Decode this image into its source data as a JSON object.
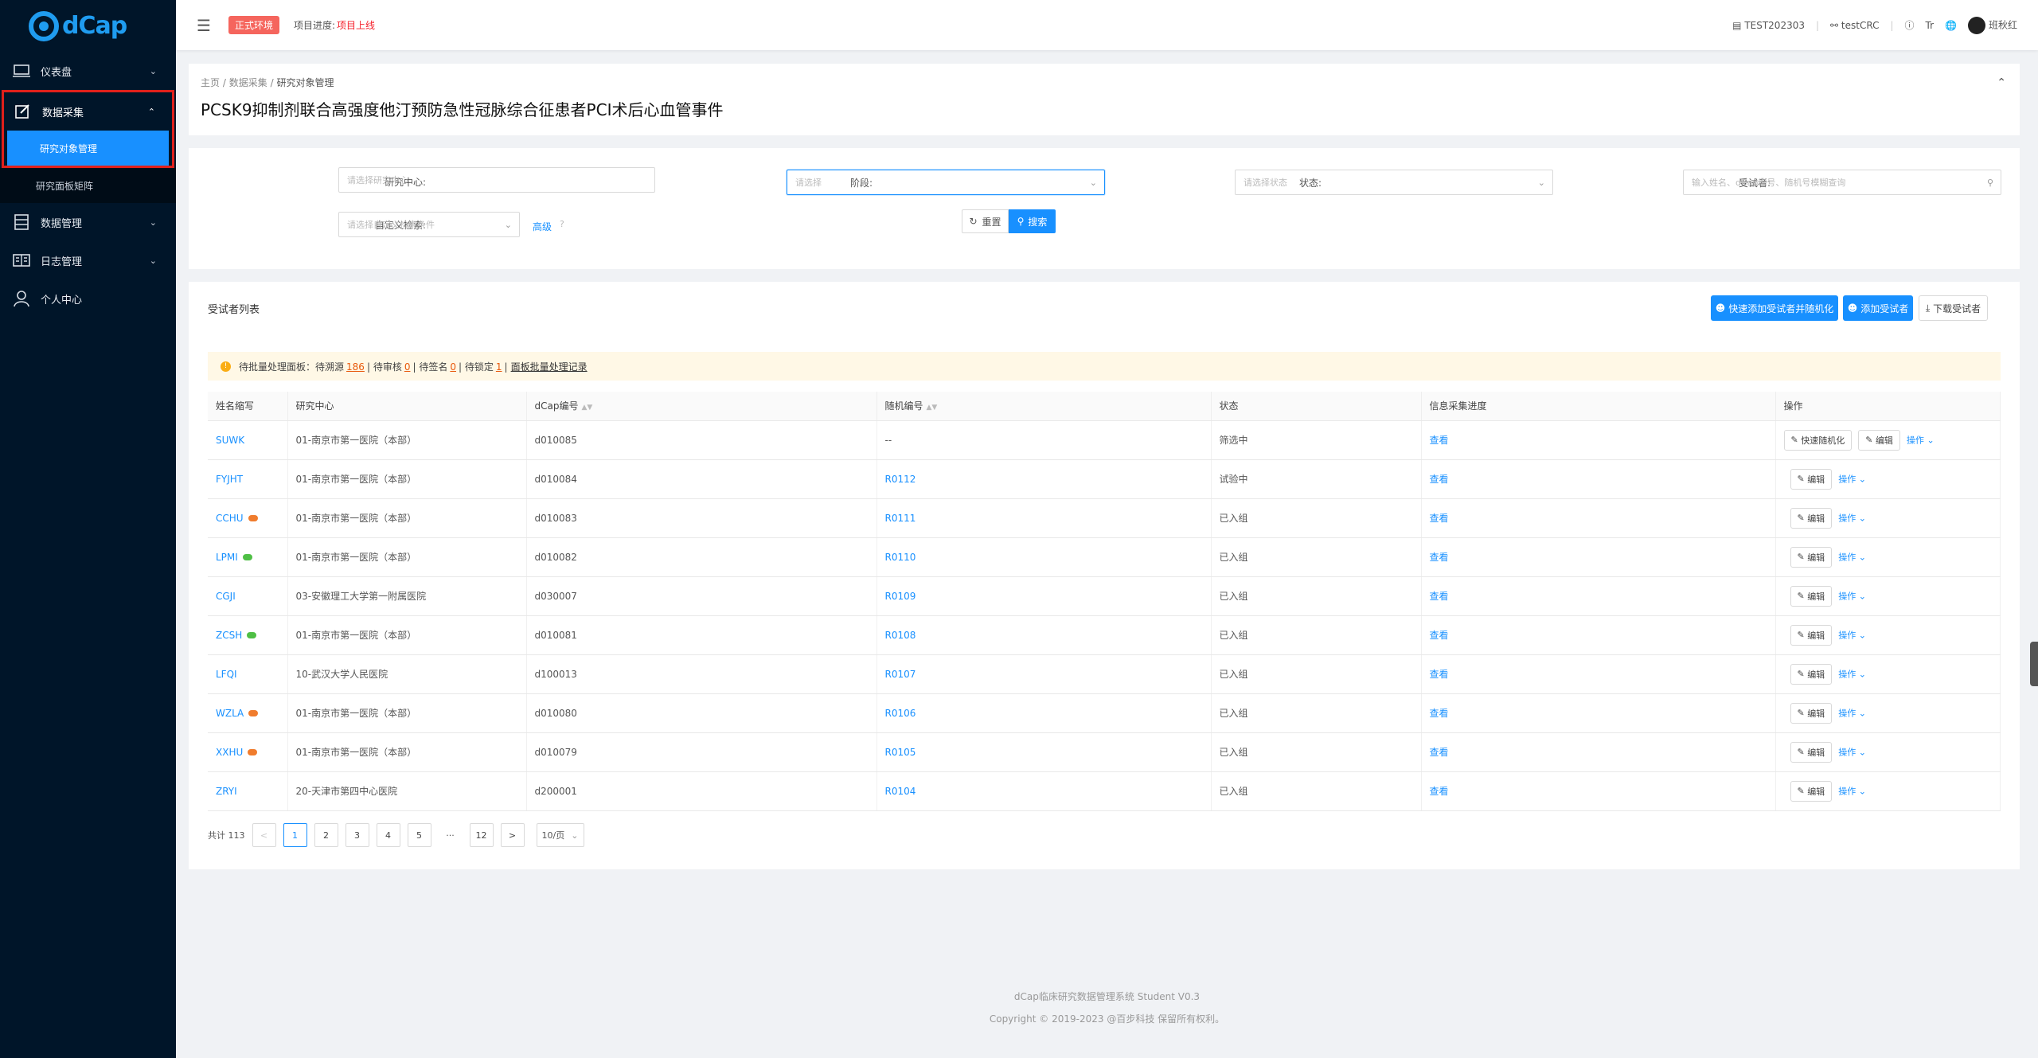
{
  "app": {
    "logo_text": "dCap"
  },
  "sidebar": {
    "items": [
      {
        "label": "仪表盘",
        "icon": "monitor-icon",
        "has_chevron": true
      },
      {
        "label": "数据采集",
        "icon": "edit-icon",
        "has_chevron": true,
        "expanded": true
      },
      {
        "label": "数据管理",
        "icon": "database-icon",
        "has_chevron": true
      },
      {
        "label": "日志管理",
        "icon": "book-icon",
        "has_chevron": true
      },
      {
        "label": "个人中心",
        "icon": "user-icon",
        "has_chevron": false
      }
    ],
    "sub_items": [
      {
        "label": "研究对象管理",
        "selected": true
      },
      {
        "label": "研究面板矩阵",
        "selected": false
      }
    ]
  },
  "topbar": {
    "env_badge": "正式环境",
    "progress_label": "项目进度:",
    "progress_value": "项目上线",
    "project_code": "TEST202303",
    "role": "testCRC",
    "font_icon_text": "Tr",
    "user_name": "班秋红"
  },
  "header": {
    "breadcrumb": [
      "主页",
      "数据采集",
      "研究对象管理"
    ],
    "breadcrumb_sep": "/",
    "title": "PCSK9抑制剂联合高强度他汀预防急性冠脉综合征患者PCI术后心血管事件"
  },
  "filters": {
    "center_label": "研究中心:",
    "center_placeholder": "请选择研究中心",
    "stage_label": "阶段:",
    "stage_placeholder": "请选择",
    "status_label": "状态:",
    "status_placeholder": "请选择状态",
    "subject_label": "受试者:",
    "subject_placeholder": "输入姓名、dCap编号、随机号模糊查询",
    "custom_label": "自定义检索:",
    "custom_placeholder": "请选择自定义检索条件",
    "advanced": "高级",
    "reset": "重置",
    "search": "搜索"
  },
  "list": {
    "title": "受试者列表",
    "quick_add_button": "快速添加受试者并随机化",
    "add_button": "添加受试者",
    "download_button": "下载受试者",
    "alert_prefix": "待批量处理面板：",
    "alert_items": [
      {
        "label": "待溯源",
        "count": "186"
      },
      {
        "label": "待审核",
        "count": "0"
      },
      {
        "label": "待签名",
        "count": "0"
      },
      {
        "label": "待锁定",
        "count": "1"
      }
    ],
    "alert_link": "面板批量处理记录",
    "columns": [
      "姓名缩写",
      "研究中心",
      "dCap编号",
      "随机编号",
      "状态",
      "信息采集进度",
      "操作"
    ],
    "rows": [
      {
        "name": "SUWK",
        "center": "01-南京市第一医院（本部）",
        "dcap": "d010085",
        "rand": "--",
        "status": "筛选中",
        "progress": "查看",
        "chat": "",
        "quick_rand": "快速随机化"
      },
      {
        "name": "FYJHT",
        "center": "01-南京市第一医院（本部）",
        "dcap": "d010084",
        "rand": "R0112",
        "status": "试验中",
        "progress": "查看",
        "chat": ""
      },
      {
        "name": "CCHU",
        "center": "01-南京市第一医院（本部）",
        "dcap": "d010083",
        "rand": "R0111",
        "status": "已入组",
        "progress": "查看",
        "chat": "orange"
      },
      {
        "name": "LPMI",
        "center": "01-南京市第一医院（本部）",
        "dcap": "d010082",
        "rand": "R0110",
        "status": "已入组",
        "progress": "查看",
        "chat": "green"
      },
      {
        "name": "CGJI",
        "center": "03-安徽理工大学第一附属医院",
        "dcap": "d030007",
        "rand": "R0109",
        "status": "已入组",
        "progress": "查看",
        "chat": ""
      },
      {
        "name": "ZCSH",
        "center": "01-南京市第一医院（本部）",
        "dcap": "d010081",
        "rand": "R0108",
        "status": "已入组",
        "progress": "查看",
        "chat": "green"
      },
      {
        "name": "LFQI",
        "center": "10-武汉大学人民医院",
        "dcap": "d100013",
        "rand": "R0107",
        "status": "已入组",
        "progress": "查看",
        "chat": ""
      },
      {
        "name": "WZLA",
        "center": "01-南京市第一医院（本部）",
        "dcap": "d010080",
        "rand": "R0106",
        "status": "已入组",
        "progress": "查看",
        "chat": "orange"
      },
      {
        "name": "XXHU",
        "center": "01-南京市第一医院（本部）",
        "dcap": "d010079",
        "rand": "R0105",
        "status": "已入组",
        "progress": "查看",
        "chat": "orange"
      },
      {
        "name": "ZRYI",
        "center": "20-天津市第四中心医院",
        "dcap": "d200001",
        "rand": "R0104",
        "status": "已入组",
        "progress": "查看",
        "chat": ""
      }
    ],
    "edit_label": "编辑",
    "op_label": "操作"
  },
  "pagination": {
    "total": "共计 113",
    "pages": [
      "1",
      "2",
      "3",
      "4",
      "5",
      "···",
      "12"
    ],
    "current": "1",
    "prev": "<",
    "next": ">",
    "page_size": "10/页"
  },
  "footer": {
    "line1": "dCap临床研究数据管理系统   Student   V0.3",
    "line2": "Copyright © 2019-2023 @百步科技 保留所有权利。"
  }
}
